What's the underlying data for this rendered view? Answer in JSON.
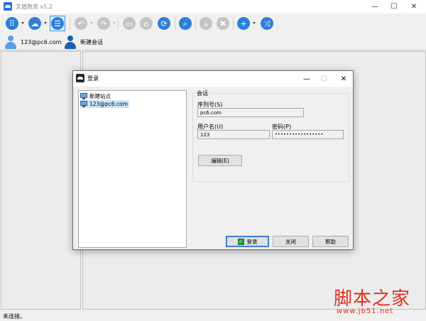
{
  "window": {
    "title": "文盾数库 v1.2",
    "controls": {
      "minimize": "—",
      "maximize": "☐",
      "close": "✕"
    }
  },
  "toolbar": {
    "buttons": [
      {
        "name": "apps",
        "icon": "grid-icon",
        "glyph": "⠿"
      },
      {
        "name": "sync",
        "icon": "cloud-sync-icon",
        "glyph": "☁"
      },
      {
        "name": "list",
        "icon": "list-icon",
        "glyph": "☰"
      },
      {
        "name": "back",
        "icon": "back-icon",
        "glyph": "↶"
      },
      {
        "name": "forward",
        "icon": "forward-icon",
        "glyph": "↷"
      },
      {
        "name": "folder",
        "icon": "folder-icon",
        "glyph": "▭"
      },
      {
        "name": "home",
        "icon": "home-icon",
        "glyph": "⌂"
      },
      {
        "name": "refresh",
        "icon": "refresh-icon",
        "glyph": "⟳"
      },
      {
        "name": "search",
        "icon": "search-icon",
        "glyph": "⌕"
      },
      {
        "name": "download",
        "icon": "download-icon",
        "glyph": "⤓"
      },
      {
        "name": "delete",
        "icon": "trash-icon",
        "glyph": "✖"
      },
      {
        "name": "add",
        "icon": "plus-icon",
        "glyph": "+"
      },
      {
        "name": "shuffle",
        "icon": "shuffle-icon",
        "glyph": "⤨"
      }
    ]
  },
  "sessions": {
    "tabs": [
      {
        "label": "123@pc6.com"
      },
      {
        "label": "新建会话"
      }
    ]
  },
  "status": {
    "text": "未连接。"
  },
  "watermark": {
    "text": "脚本之家",
    "url": "www.jb51.net"
  },
  "dialog": {
    "title": "登录",
    "tree": [
      {
        "label": "新建站点",
        "selected": false
      },
      {
        "label": "123@pc6.com",
        "selected": true
      }
    ],
    "group_title": "会话",
    "serial": {
      "label": "序列号(S)",
      "value": "pc6.com"
    },
    "username": {
      "label": "用户名(U)",
      "value": "123"
    },
    "password": {
      "label": "密码(P)",
      "value": "•••••••••••••••••"
    },
    "edit_button": "编辑(E)",
    "login_button": "登录",
    "close_button": "关闭",
    "help_button": "帮助"
  }
}
